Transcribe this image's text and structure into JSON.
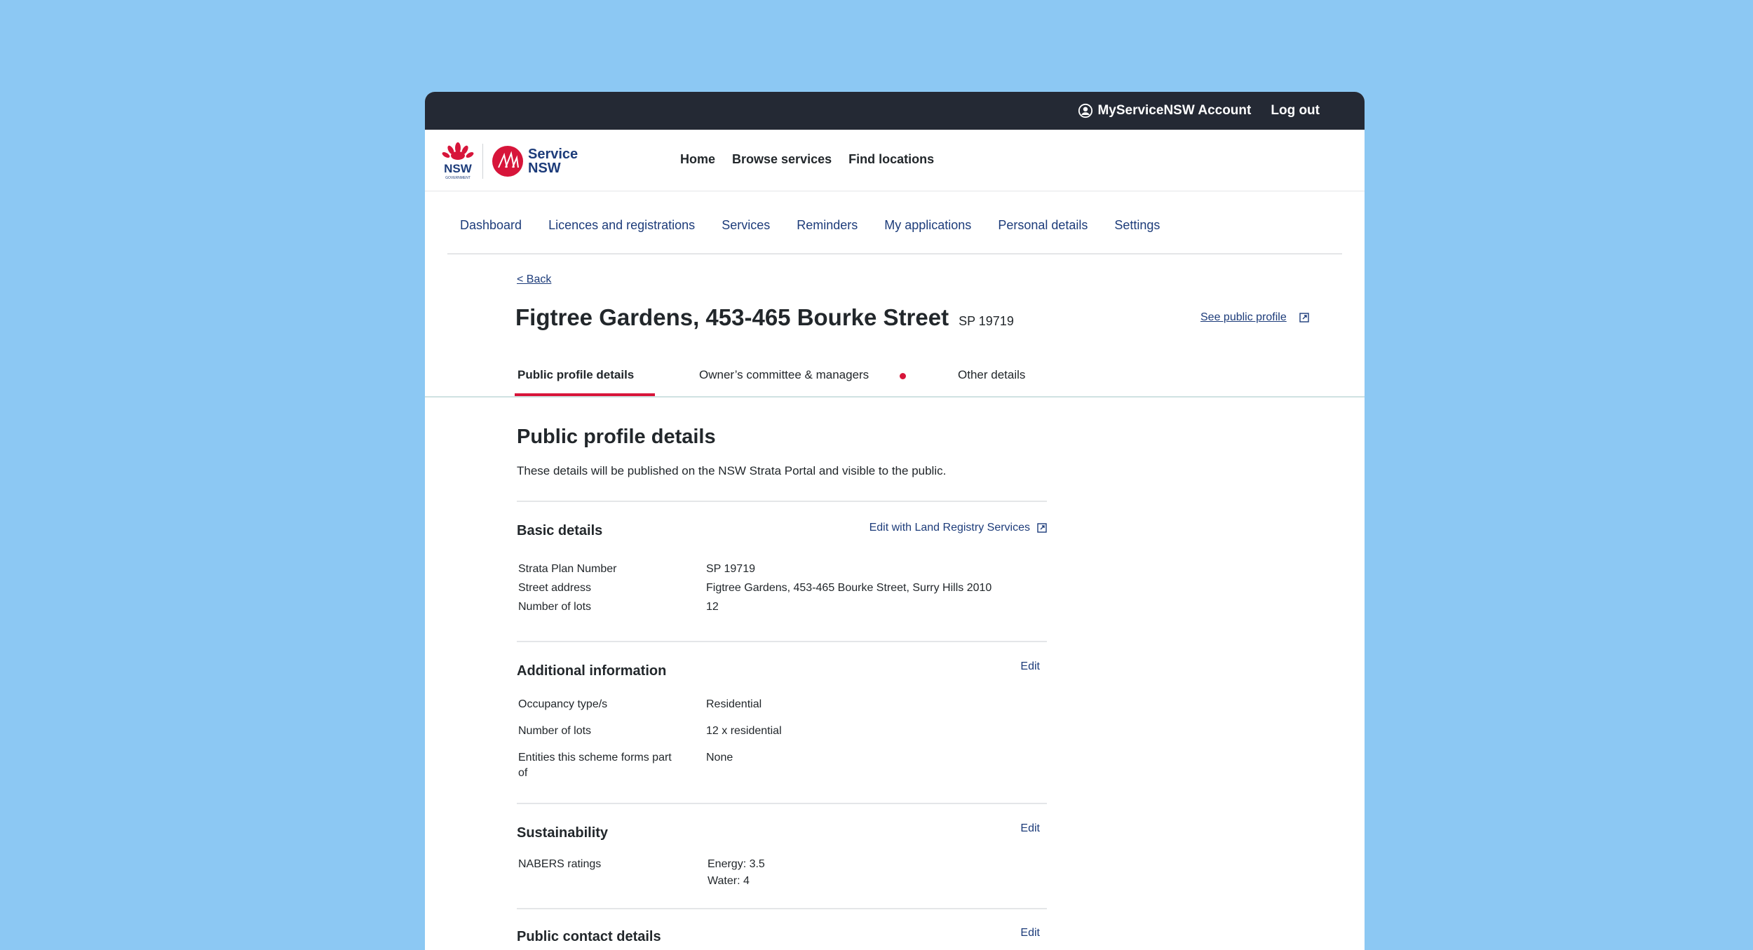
{
  "topbar": {
    "account_label": "MyServiceNSW Account",
    "logout_label": "Log out"
  },
  "header": {
    "logo_nsw": "NSW",
    "logo_government": "GOVERNMENT",
    "logo_service_line1": "Service",
    "logo_service_line2": "NSW",
    "nav": [
      "Home",
      "Browse services",
      "Find locations"
    ]
  },
  "subnav": [
    "Dashboard",
    "Licences and registrations",
    "Services",
    "Reminders",
    "My applications",
    "Personal details",
    "Settings"
  ],
  "page": {
    "back_label": "< Back",
    "title": "Figtree Gardens, 453-465 Bourke Street",
    "plan_number": "SP 19719",
    "public_profile_link": "See public profile"
  },
  "tabs": [
    "Public profile details",
    "Owner’s committee & managers",
    "Other details"
  ],
  "content": {
    "heading": "Public profile details",
    "intro": "These details will be published on the NSW Strata Portal and visible to the public.",
    "basic": {
      "title": "Basic details",
      "action": "Edit with Land Registry Services",
      "rows": [
        {
          "label": "Strata Plan Number",
          "value": "SP 19719"
        },
        {
          "label": "Street address",
          "value": "Figtree Gardens, 453-465 Bourke Street, Surry Hills 2010"
        },
        {
          "label": "Number of lots",
          "value": "12"
        }
      ]
    },
    "additional": {
      "title": "Additional information",
      "action": "Edit",
      "rows": [
        {
          "label": "Occupancy type/s",
          "value": "Residential"
        },
        {
          "label": "Number of lots",
          "value": "12 x residential"
        },
        {
          "label": "Entities this scheme forms part of",
          "value": "None"
        }
      ]
    },
    "sustainability": {
      "title": "Sustainability",
      "action": "Edit",
      "label": "NABERS ratings",
      "energy": "Energy: 3.5",
      "water": "Water: 4"
    },
    "contact": {
      "title": "Public contact details",
      "action": "Edit"
    }
  },
  "colors": {
    "background": "#8cc8f3",
    "topbar": "#242934",
    "link": "#1d3c7a",
    "accent_red": "#d7153a"
  }
}
